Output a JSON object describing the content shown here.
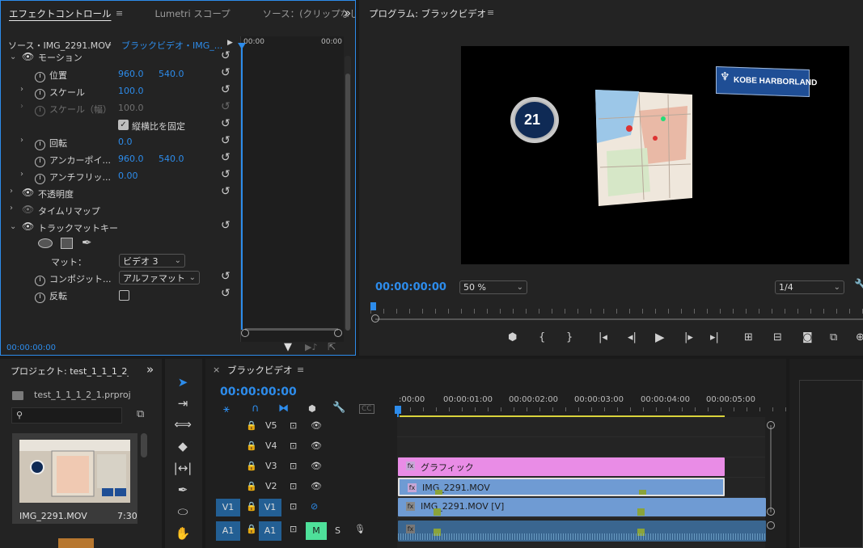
{
  "effects_panel": {
    "tabs": [
      "エフェクトコントロール",
      "Lumetri スコープ",
      "ソース：(クリップなし"
    ],
    "menu_icon": "≡",
    "overflow_icon": "»",
    "source_label": "ソース・IMG_2291.MOV",
    "sequence_label": "ブラックビデオ・IMG_...",
    "ruler_start": "00:00",
    "ruler_end": "00:00",
    "sections": {
      "motion": "モーション",
      "opacity": "不透明度",
      "time_remap": "タイムリマップ",
      "track_matte": "トラックマットキー"
    },
    "props": {
      "position": {
        "label": "位置",
        "x": "960.0",
        "y": "540.0"
      },
      "scale": {
        "label": "スケール",
        "value": "100.0"
      },
      "scale_width": {
        "label": "スケール（幅）",
        "value": "100.0"
      },
      "uniform": "縦横比を固定",
      "rotation": {
        "label": "回転",
        "value": "0.0"
      },
      "anchor": {
        "label": "アンカーポイ...",
        "x": "960.0",
        "y": "540.0"
      },
      "antiflicker": {
        "label": "アンチフリッ...",
        "value": "0.00"
      },
      "matte": {
        "label": "マット：",
        "value": "ビデオ 3"
      },
      "composite": {
        "label": "コンポジット...",
        "value": "アルファマット"
      },
      "reverse": {
        "label": "反転"
      }
    },
    "timecode": "00:00:00:00"
  },
  "program": {
    "title": "プログラム: ブラックビデオ",
    "menu_icon": "≡",
    "timecode": "00:00:00:00",
    "zoom": "50 %",
    "resolution": "1/4",
    "sign_text": "KOBE HARBORLAND",
    "badge_number": "21"
  },
  "project": {
    "title": "プロジェクト: test_1_1_1_2_1",
    "file": "test_1_1_1_2_1.prproj",
    "clip_name": "IMG_2291.MOV",
    "clip_duration": "7:30"
  },
  "timeline": {
    "title": "ブラックビデオ",
    "close_icon": "×",
    "menu_icon": "≡",
    "timecode": "00:00:00:00",
    "ruler": [
      ":00:00",
      "00:00:01:00",
      "00:00:02:00",
      "00:00:03:00",
      "00:00:04:00",
      "00:00:05:00"
    ],
    "tracks": [
      {
        "label": "V5"
      },
      {
        "label": "V4"
      },
      {
        "label": "V3"
      },
      {
        "label": "V2"
      },
      {
        "label": "V1",
        "src": "V1"
      },
      {
        "label": "A1",
        "src": "A1"
      }
    ],
    "mute": "M",
    "solo": "S",
    "clips": {
      "graphic": "グラフィック",
      "v2": "IMG_2291.MOV",
      "v1": "IMG_2291.MOV [V]"
    }
  },
  "colors": {
    "accent": "#2d8ceb",
    "graphic_clip": "#e98ce6",
    "video_clip": "#6f9bd3",
    "audio_clip": "#3a6690"
  }
}
